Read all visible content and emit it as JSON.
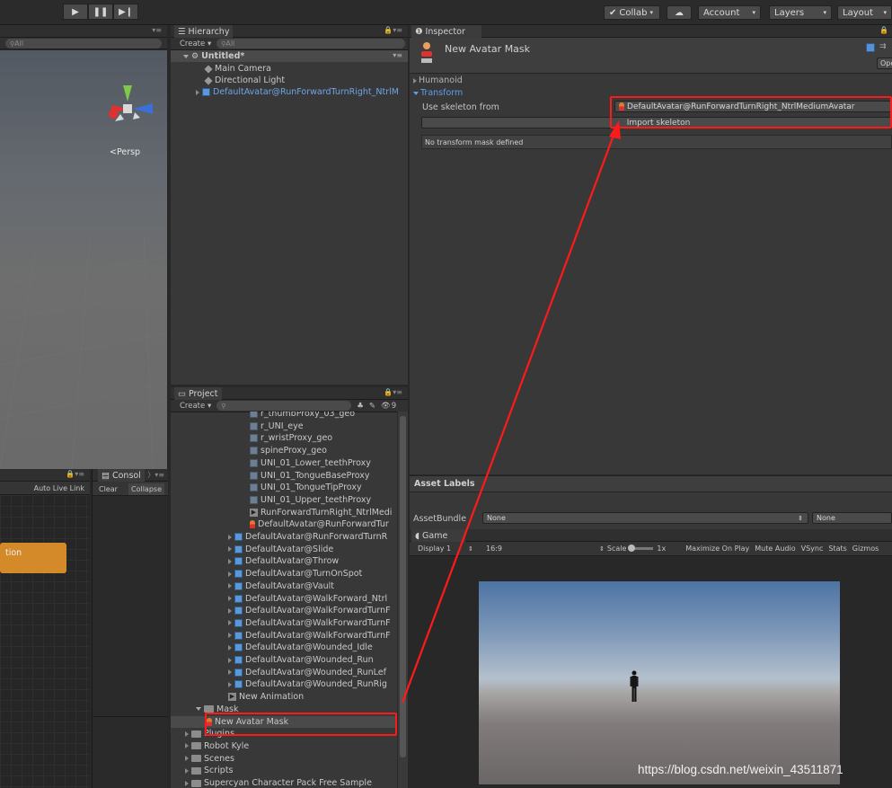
{
  "toolbar": {
    "collab": "Collab",
    "account": "Account",
    "layers": "Layers",
    "layout": "Layout"
  },
  "scene": {
    "search": "All",
    "persp": "Persp"
  },
  "hierarchy": {
    "tab": "Hierarchy",
    "create": "Create",
    "search": "All",
    "scene": "Untitled*",
    "items": [
      "Main Camera",
      "Directional Light",
      "DefaultAvatar@RunForwardTurnRight_NtrlM"
    ]
  },
  "inspector": {
    "tab": "Inspector",
    "title": "New Avatar Mask",
    "open": "Ope",
    "humanoid": "Humanoid",
    "transform": "Transform",
    "use_skeleton_label": "Use skeleton from",
    "skeleton_value": "DefaultAvatar@RunForwardTurnRight_NtrlMediumAvatar",
    "import_button": "Import skeleton",
    "no_mask": "No transform mask defined"
  },
  "asset_labels": {
    "title": "Asset Labels",
    "bundle_label": "AssetBundle",
    "bundle_value": "None",
    "variant_value": "None"
  },
  "game": {
    "tab": "Game",
    "display": "Display 1",
    "aspect": "16:9",
    "scale_label": "Scale",
    "scale_value": "1x",
    "maximize": "Maximize On Play",
    "mute": "Mute Audio",
    "vsync": "VSync",
    "stats": "Stats",
    "gizmos": "Gizmos"
  },
  "project": {
    "tab": "Project",
    "create": "Create",
    "count": "9",
    "items": [
      {
        "label": "r_thumbProxy_03_geo",
        "icon": "mesh",
        "indent": 88
      },
      {
        "label": "r_UNI_eye",
        "icon": "mesh",
        "indent": 88
      },
      {
        "label": "r_wristProxy_geo",
        "icon": "mesh",
        "indent": 88
      },
      {
        "label": "spineProxy_geo",
        "icon": "mesh",
        "indent": 88
      },
      {
        "label": "UNI_01_Lower_teethProxy",
        "icon": "mesh",
        "indent": 88
      },
      {
        "label": "UNI_01_TongueBaseProxy",
        "icon": "mesh",
        "indent": 88
      },
      {
        "label": "UNI_01_TongueTipProxy",
        "icon": "mesh",
        "indent": 88
      },
      {
        "label": "UNI_01_Upper_teethProxy",
        "icon": "mesh",
        "indent": 88
      },
      {
        "label": "RunForwardTurnRight_NtrlMedi",
        "icon": "anim",
        "indent": 88
      },
      {
        "label": "DefaultAvatar@RunForwardTur",
        "icon": "avatar",
        "indent": 88
      },
      {
        "label": "DefaultAvatar@RunForwardTurnR",
        "icon": "cube",
        "indent": 64,
        "arrow": true
      },
      {
        "label": "DefaultAvatar@Slide",
        "icon": "cube",
        "indent": 64,
        "arrow": true
      },
      {
        "label": "DefaultAvatar@Throw",
        "icon": "cube",
        "indent": 64,
        "arrow": true
      },
      {
        "label": "DefaultAvatar@TurnOnSpot",
        "icon": "cube",
        "indent": 64,
        "arrow": true
      },
      {
        "label": "DefaultAvatar@Vault",
        "icon": "cube",
        "indent": 64,
        "arrow": true
      },
      {
        "label": "DefaultAvatar@WalkForward_Ntrl",
        "icon": "cube",
        "indent": 64,
        "arrow": true
      },
      {
        "label": "DefaultAvatar@WalkForwardTurnF",
        "icon": "cube",
        "indent": 64,
        "arrow": true
      },
      {
        "label": "DefaultAvatar@WalkForwardTurnF",
        "icon": "cube",
        "indent": 64,
        "arrow": true
      },
      {
        "label": "DefaultAvatar@WalkForwardTurnF",
        "icon": "cube",
        "indent": 64,
        "arrow": true
      },
      {
        "label": "DefaultAvatar@Wounded_Idle",
        "icon": "cube",
        "indent": 64,
        "arrow": true
      },
      {
        "label": "DefaultAvatar@Wounded_Run",
        "icon": "cube",
        "indent": 64,
        "arrow": true
      },
      {
        "label": "DefaultAvatar@Wounded_RunLef",
        "icon": "cube",
        "indent": 64,
        "arrow": true
      },
      {
        "label": "DefaultAvatar@Wounded_RunRig",
        "icon": "cube",
        "indent": 64,
        "arrow": true
      },
      {
        "label": "New Animation",
        "icon": "anim",
        "indent": 64
      },
      {
        "label": "Mask",
        "icon": "folder",
        "indent": 28,
        "open": true
      },
      {
        "label": "New Avatar Mask",
        "icon": "mask",
        "indent": 40,
        "selected": true
      },
      {
        "label": "Plugins",
        "icon": "folder",
        "indent": 16,
        "arrow": true
      },
      {
        "label": "Robot Kyle",
        "icon": "folder",
        "indent": 16,
        "arrow": true
      },
      {
        "label": "Scenes",
        "icon": "folder",
        "indent": 16,
        "arrow": true
      },
      {
        "label": "Scripts",
        "icon": "folder",
        "indent": 16,
        "arrow": true
      },
      {
        "label": "Supercyan Character Pack Free Sample",
        "icon": "folder",
        "indent": 16,
        "arrow": true
      }
    ]
  },
  "animator": {
    "autolive": "Auto Live Link",
    "state": "tion"
  },
  "console": {
    "tab": "Consol",
    "clear": "Clear",
    "collapse": "Collapse"
  },
  "watermark": "https://blog.csdn.net/weixin_43511871"
}
